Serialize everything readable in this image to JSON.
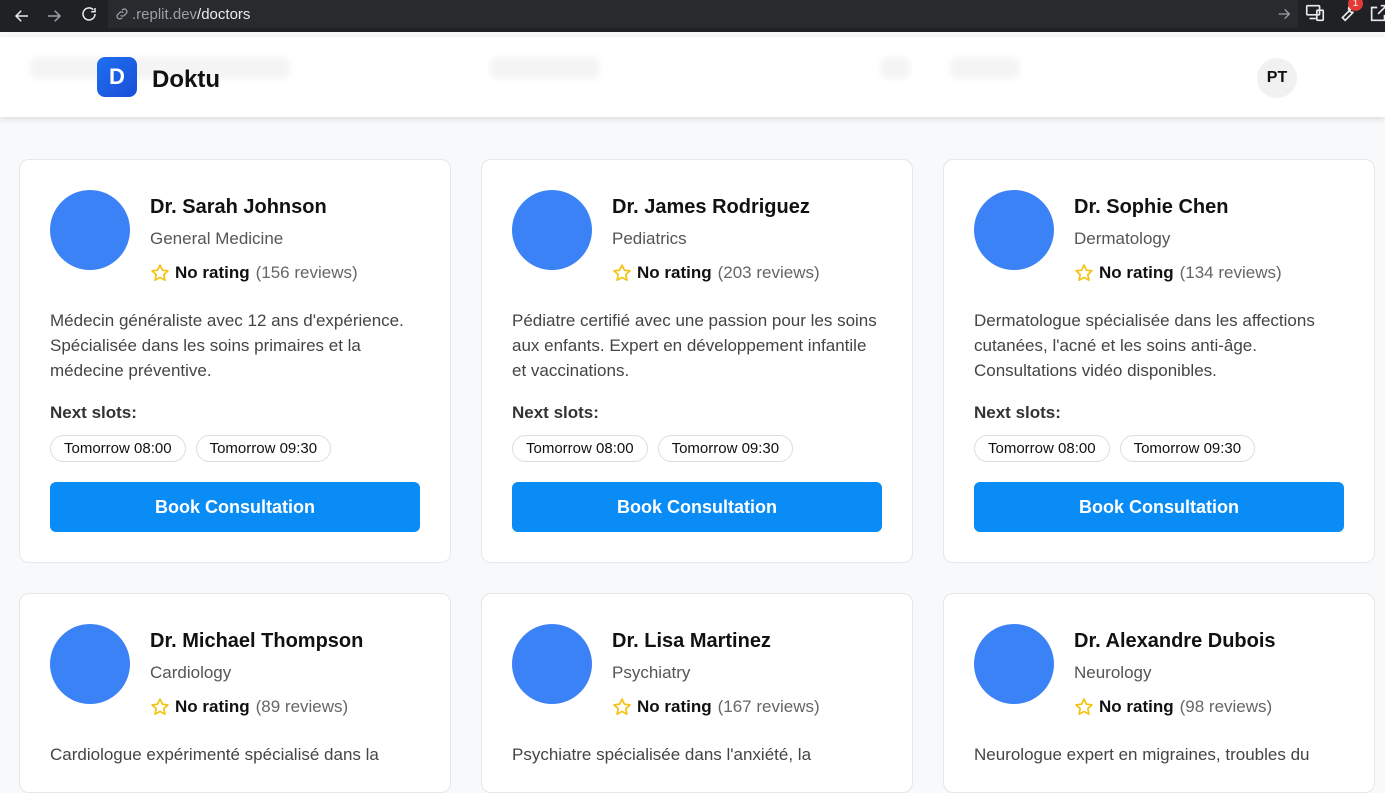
{
  "browser": {
    "url_host": ".replit.dev",
    "url_path": "/doctors",
    "extension_badge": "1"
  },
  "header": {
    "logo_letter": "D",
    "app_name": "Doktu",
    "avatar_initials": "PT"
  },
  "colors": {
    "accent": "#0a8cf7",
    "avatar_placeholder": "#3b82f6",
    "star": "#f4c20d"
  },
  "doctors": [
    {
      "name": "Dr. Sarah Johnson",
      "specialty": "General Medicine",
      "rating_label": "No rating",
      "reviews": "(156 reviews)",
      "description": "Médecin généraliste avec 12 ans d'expérience. Spécialisée dans les soins primaires et la médecine préventive.",
      "slots_label": "Next slots:",
      "slots": [
        "Tomorrow 08:00",
        "Tomorrow 09:30"
      ],
      "button": "Book Consultation"
    },
    {
      "name": "Dr. James Rodriguez",
      "specialty": "Pediatrics",
      "rating_label": "No rating",
      "reviews": "(203 reviews)",
      "description": "Pédiatre certifié avec une passion pour les soins aux enfants. Expert en développement infantile et vaccinations.",
      "slots_label": "Next slots:",
      "slots": [
        "Tomorrow 08:00",
        "Tomorrow 09:30"
      ],
      "button": "Book Consultation"
    },
    {
      "name": "Dr. Sophie Chen",
      "specialty": "Dermatology",
      "rating_label": "No rating",
      "reviews": "(134 reviews)",
      "description": "Dermatologue spécialisée dans les affections cutanées, l'acné et les soins anti-âge. Consultations vidéo disponibles.",
      "slots_label": "Next slots:",
      "slots": [
        "Tomorrow 08:00",
        "Tomorrow 09:30"
      ],
      "button": "Book Consultation"
    },
    {
      "name": "Dr. Michael Thompson",
      "specialty": "Cardiology",
      "rating_label": "No rating",
      "reviews": "(89 reviews)",
      "description": "Cardiologue expérimenté spécialisé dans la",
      "slots_label": "",
      "slots": [],
      "button": ""
    },
    {
      "name": "Dr. Lisa Martinez",
      "specialty": "Psychiatry",
      "rating_label": "No rating",
      "reviews": "(167 reviews)",
      "description": "Psychiatre spécialisée dans l'anxiété, la",
      "slots_label": "",
      "slots": [],
      "button": ""
    },
    {
      "name": "Dr. Alexandre Dubois",
      "specialty": "Neurology",
      "rating_label": "No rating",
      "reviews": "(98 reviews)",
      "description": "Neurologue expert en migraines, troubles du",
      "slots_label": "",
      "slots": [],
      "button": ""
    }
  ]
}
